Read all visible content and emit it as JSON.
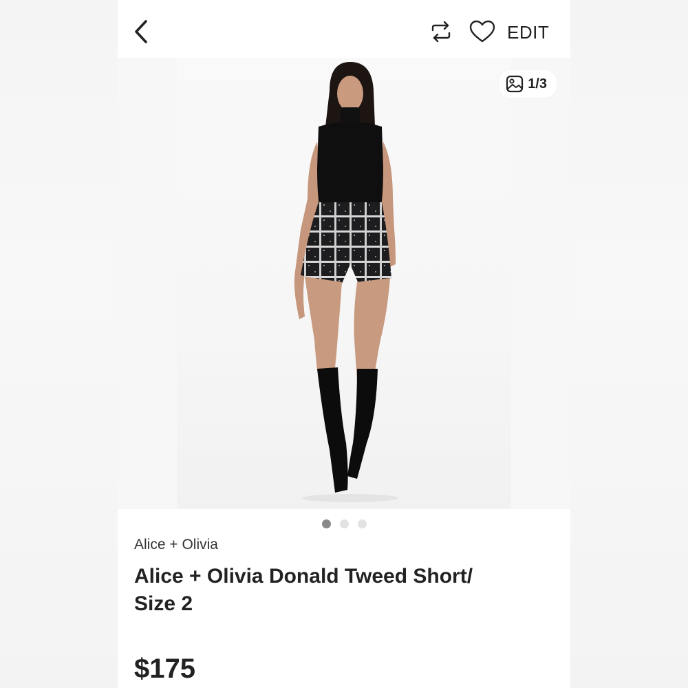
{
  "header": {
    "edit_label": "EDIT",
    "icons": {
      "back": "chevron-left-icon",
      "repost": "repost-icon",
      "like": "heart-icon"
    }
  },
  "gallery": {
    "photo_counter": "1/3",
    "current_index": 1,
    "total": 3,
    "photo_icon": "image-icon"
  },
  "listing": {
    "brand": "Alice + Olivia",
    "title_line1": "Alice + Olivia Donald Tweed Short/",
    "title_line2": "Size 2",
    "price": "$175"
  },
  "colors": {
    "text": "#222222",
    "dot_active": "#8a8a8a",
    "dot_inactive": "#e2e2e2"
  }
}
